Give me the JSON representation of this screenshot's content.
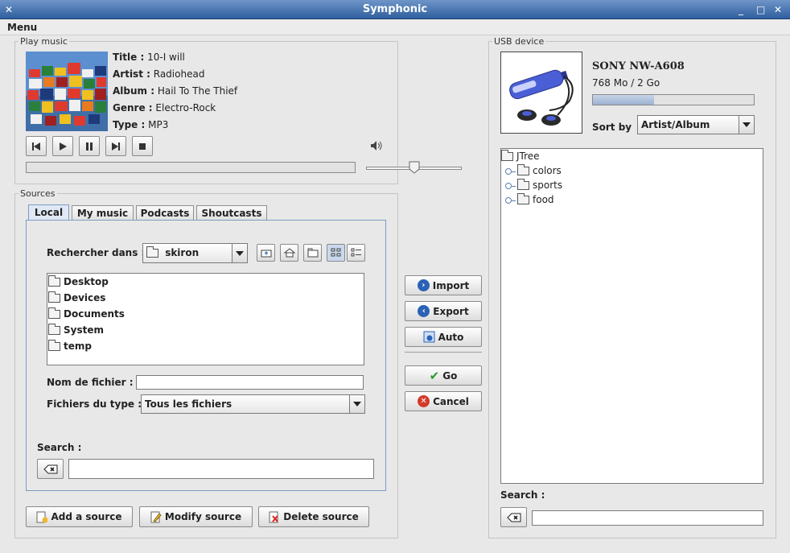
{
  "window": {
    "title": "Symphonic"
  },
  "menu": {
    "label": "Menu"
  },
  "play_music": {
    "legend": "Play music",
    "title_label": "Title :",
    "title_value": "10-I will",
    "artist_label": "Artist :",
    "artist_value": "Radiohead",
    "album_label": "Album :",
    "album_value": "Hail To The Thief",
    "genre_label": "Genre :",
    "genre_value": "Electro-Rock",
    "type_label": "Type :",
    "type_value": "MP3",
    "progress": 0.0,
    "volume": 0.5
  },
  "sources": {
    "legend": "Sources",
    "tabs": [
      "Local",
      "My music",
      "Podcasts",
      "Shoutcasts"
    ],
    "look_in_label": "Rechercher dans :",
    "look_in_value": "skiron",
    "files": [
      "Desktop",
      "Devices",
      "Documents",
      "System",
      "temp"
    ],
    "filename_label": "Nom de fichier :",
    "filename_value": "",
    "filetype_label": "Fichiers du type :",
    "filetype_value": "Tous les fichiers",
    "search_label": "Search :",
    "search_value": "",
    "add_label": "Add a source",
    "modify_label": "Modify source",
    "delete_label": "Delete source"
  },
  "actions": {
    "import": "Import",
    "export": "Export",
    "auto": "Auto",
    "go": "Go",
    "cancel": "Cancel"
  },
  "usb": {
    "legend": "USB device",
    "device_name": "SONY NW-A608",
    "capacity": "768 Mo / 2 Go",
    "usage_fraction": 0.38,
    "sort_label": "Sort by",
    "sort_value": "Artist/Album",
    "tree_root": "JTree",
    "tree_children": [
      "colors",
      "sports",
      "food"
    ],
    "search_label": "Search :",
    "search_value": ""
  },
  "colors": {
    "titlebar": "#3c6aa8",
    "accent": "#2a62b6",
    "go_green": "#2e9a2e",
    "cancel_red": "#d23a2a"
  }
}
